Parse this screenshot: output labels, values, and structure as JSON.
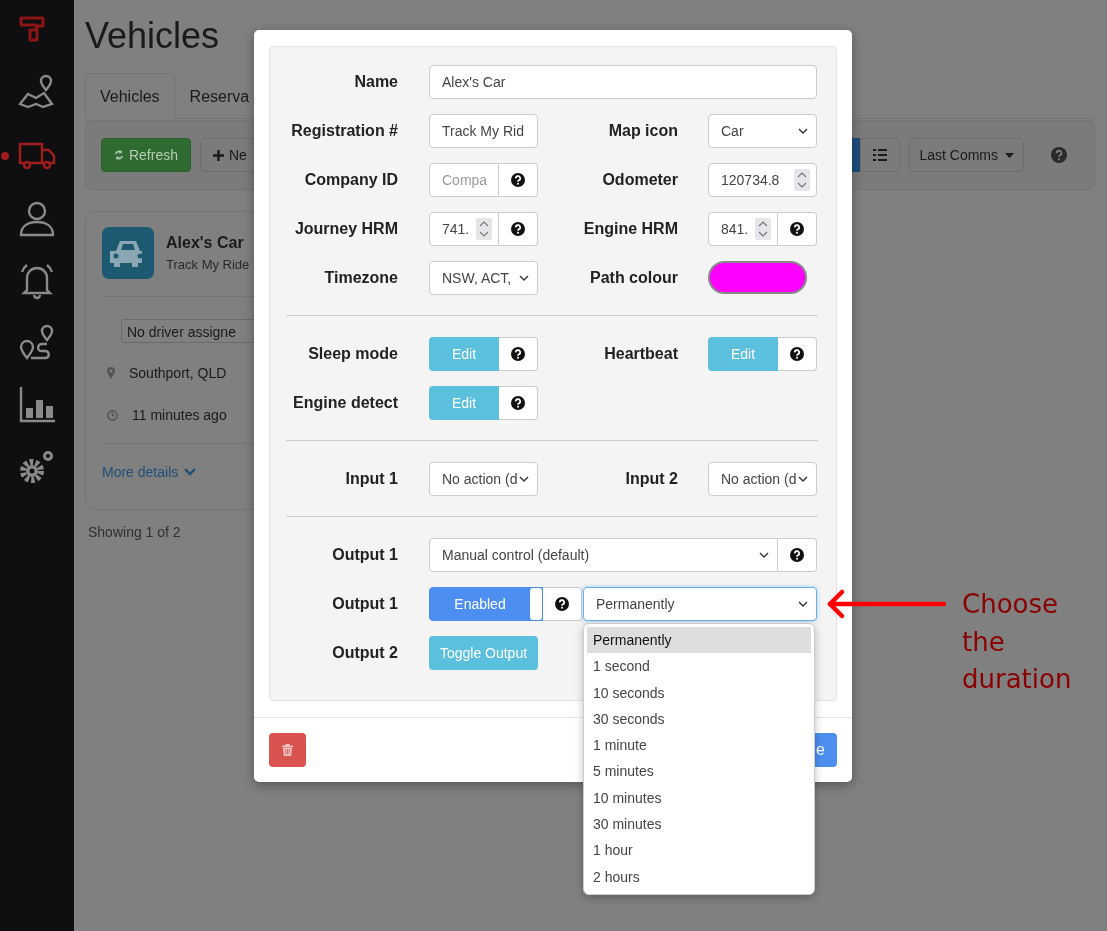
{
  "sidebar": {
    "items": [
      {
        "kind": "logo"
      },
      {
        "kind": "map",
        "selected": false
      },
      {
        "kind": "truck",
        "selected": true
      },
      {
        "kind": "person",
        "selected": false
      },
      {
        "kind": "bell",
        "selected": false
      },
      {
        "kind": "route",
        "selected": false
      },
      {
        "kind": "chart",
        "selected": false
      },
      {
        "kind": "gears",
        "selected": false
      }
    ]
  },
  "page": {
    "title": "Vehicles",
    "tabs": [
      {
        "label": "Vehicles",
        "selected": true
      },
      {
        "label": "Reserva",
        "selected": false
      }
    ],
    "toolbar": {
      "refresh": "Refresh",
      "new": "Ne",
      "views": [
        {
          "kind": "grid",
          "selected": true
        },
        {
          "kind": "list",
          "selected": false
        }
      ],
      "sort": "Last Comms"
    },
    "vehicle_card": {
      "name": "Alex's Car",
      "subtitle": "Track My Ride",
      "driver": "No driver assigne",
      "location": "Southport, QLD",
      "last_seen": "11 minutes ago",
      "more": "More details"
    },
    "footer": "Showing 1 of 2"
  },
  "modal": {
    "rows": [
      {
        "kind": "fields",
        "fields": [
          {
            "label": "Name",
            "kind": "long_text",
            "value": "Alex's Car"
          }
        ]
      },
      {
        "kind": "fields",
        "fields": [
          {
            "label": "Registration #",
            "kind": "text",
            "value": "Track My Rid"
          },
          {
            "label": "Map icon",
            "kind": "select",
            "value": "Car"
          }
        ]
      },
      {
        "kind": "fields",
        "fields": [
          {
            "label": "Company ID",
            "kind": "text",
            "placeholder": "Compa",
            "help": true
          },
          {
            "label": "Odometer",
            "kind": "number",
            "value": "120734.8"
          }
        ]
      },
      {
        "kind": "fields",
        "fields": [
          {
            "label": "Journey HRM",
            "kind": "number",
            "value": "741.",
            "help": true
          },
          {
            "label": "Engine HRM",
            "kind": "number",
            "value": "841.",
            "help": true
          }
        ]
      },
      {
        "kind": "fields",
        "fields": [
          {
            "label": "Timezone",
            "kind": "select",
            "value": "NSW, ACT,"
          },
          {
            "label": "Path colour",
            "kind": "color",
            "color": "#ff00ff"
          }
        ]
      },
      {
        "kind": "divider"
      },
      {
        "kind": "fields",
        "fields": [
          {
            "label": "Sleep mode",
            "kind": "edit",
            "value": "Edit",
            "help": true
          },
          {
            "label": "Heartbeat",
            "kind": "edit",
            "value": "Edit",
            "help": true
          }
        ]
      },
      {
        "kind": "fields",
        "fields": [
          {
            "label": "Engine detect",
            "kind": "edit",
            "value": "Edit",
            "help": true
          }
        ]
      },
      {
        "kind": "divider"
      },
      {
        "kind": "fields",
        "fields": [
          {
            "label": "Input 1",
            "kind": "select",
            "value": "No action (d"
          },
          {
            "label": "Input 2",
            "kind": "select",
            "value": "No action (d"
          }
        ]
      },
      {
        "kind": "divider"
      },
      {
        "kind": "fields",
        "fields": [
          {
            "label": "Output 1",
            "kind": "long_select",
            "value": "Manual control (default)",
            "help": true
          }
        ]
      },
      {
        "kind": "fields",
        "fields": [
          {
            "label": "Output 1",
            "kind": "toggle_select",
            "toggle": {
              "label": "Enabled",
              "on": true
            },
            "help": true,
            "value": "Permanently",
            "expanded": true,
            "options": [
              {
                "label": "Permanently",
                "selected": true
              },
              {
                "label": "1 second",
                "selected": false
              },
              {
                "label": "10 seconds",
                "selected": false
              },
              {
                "label": "30 seconds",
                "selected": false
              },
              {
                "label": "1 minute",
                "selected": false
              },
              {
                "label": "5 minutes",
                "selected": false
              },
              {
                "label": "10 minutes",
                "selected": false
              },
              {
                "label": "30 minutes",
                "selected": false
              },
              {
                "label": "1 hour",
                "selected": false
              },
              {
                "label": "2 hours",
                "selected": false
              }
            ]
          }
        ]
      },
      {
        "kind": "fields",
        "fields": [
          {
            "label": "Output 2",
            "kind": "button",
            "value": "Toggle Output"
          }
        ]
      }
    ],
    "save_button": "e"
  },
  "annotation": {
    "text": "Choose the duration"
  }
}
